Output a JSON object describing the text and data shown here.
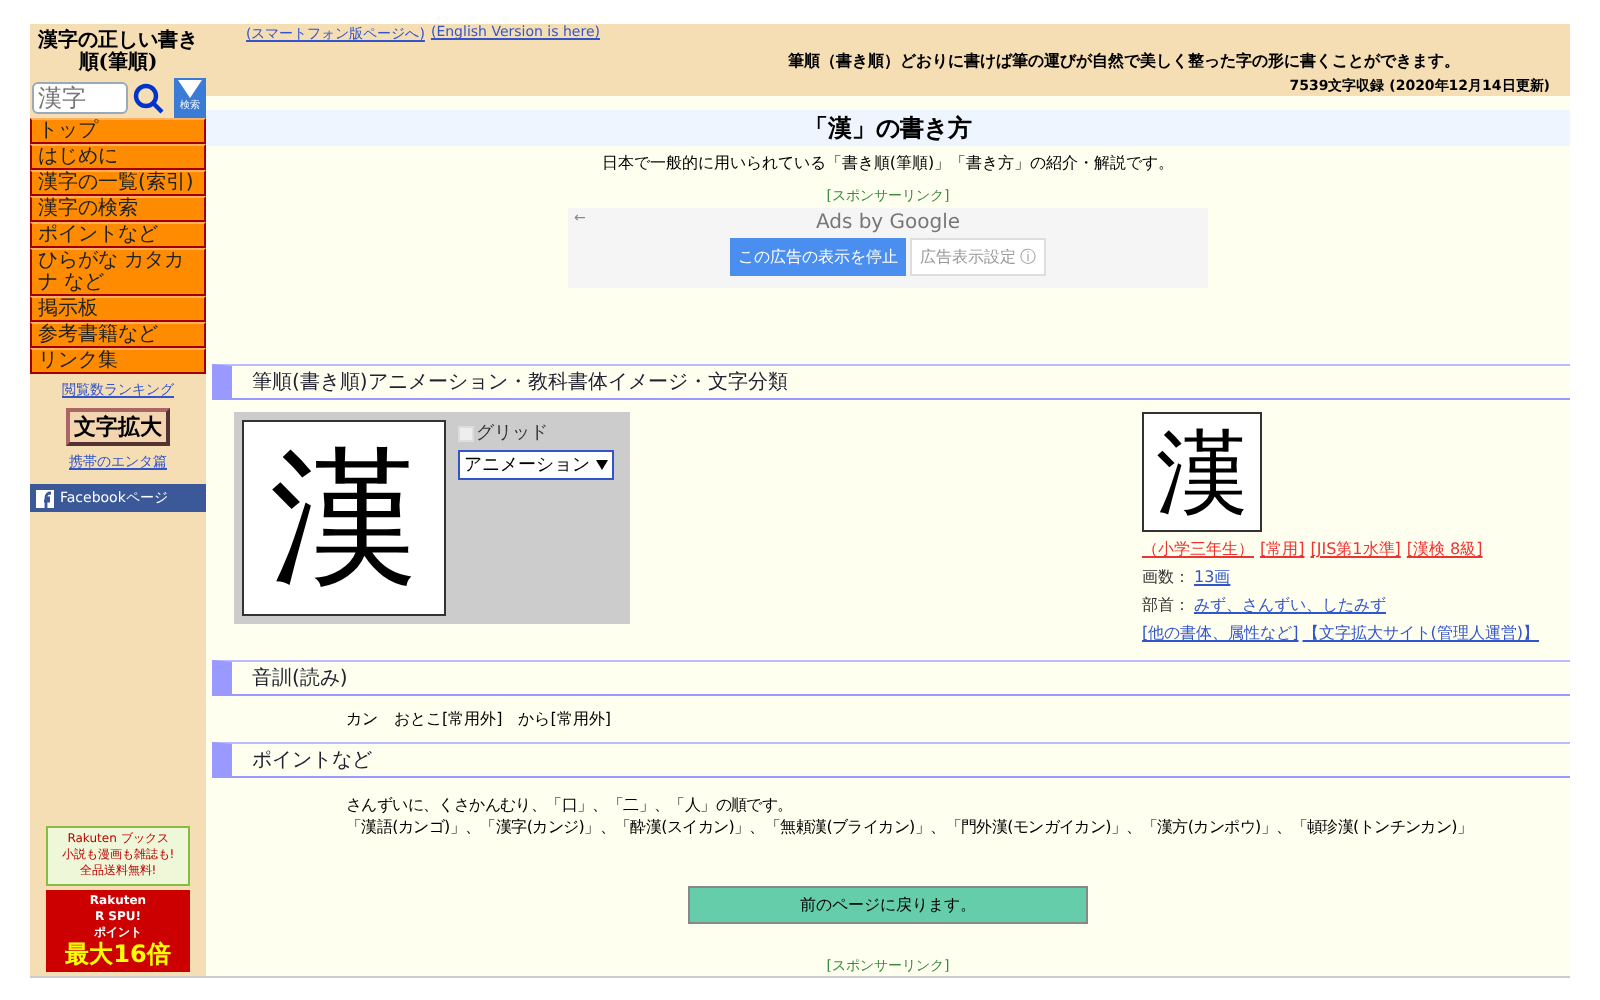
{
  "sidebar": {
    "logo": "漢字の正しい書き順(筆順)",
    "search": {
      "placeholder": "漢字"
    },
    "search_button": "検索",
    "menu": [
      "トップ",
      "はじめに",
      "漢字の一覧(索引)",
      "漢字の検索",
      "ポイントなど",
      "ひらがな カタカナ など",
      "掲示板",
      "参考書籍など",
      "リンク集"
    ],
    "ranking_link": "閲覧数ランキング",
    "zoom_button": "文字拡大",
    "zoom_link": "携帯のエンタ篇",
    "facebook_button": "Facebookページ",
    "banners": [
      {
        "lines": [
          "Rakuten ブックス",
          "小説も漫画も雑誌も!",
          "全品送料無料!"
        ]
      },
      {
        "lines": [
          "Rakuten",
          "R SPU!",
          "ポイント",
          "最大16倍"
        ]
      }
    ]
  },
  "header": {
    "links": [
      "(スマートフォン版ページへ)",
      "(English Version is here)"
    ],
    "tagline": "筆順（書き順）どおりに書けば筆の運びが自然で美しく整った字の形に書くことができます。",
    "count": "7539文字収録 (2020年12月14日更新)"
  },
  "title": "「漢」の書き方",
  "intro": "日本で一般的に用いられている「書き順(筆順)」「書き方」の紹介・解説です。",
  "sponsor": "[スポンサーリンク]",
  "ad": {
    "back": "←",
    "ads_by": "Ads by Google",
    "stop_button": "この広告の表示を停止",
    "settings_button": "広告表示設定 ⓘ"
  },
  "sections": [
    {
      "heading": "筆順(書き順)アニメーション・教科書体イメージ・文字分類"
    },
    {
      "heading": "音訓(読み)"
    },
    {
      "heading": "ポイントなど"
    }
  ],
  "stroke_panel": {
    "kanji": "漢",
    "grid": {
      "label": "グリッド",
      "checked": false
    },
    "mode": "アニメーション"
  },
  "info": {
    "kanji": "漢",
    "tags": [
      "（小学三年生）",
      "[常用]",
      "[JIS第1水準]",
      "[漢検 8級]"
    ],
    "strokes_label": "画数：",
    "strokes": "13画",
    "radical_label": "部首：",
    "radical": "みず、さんずい、したみず",
    "links": [
      "[他の書体、属性など]",
      "【文字拡大サイト(管理人運営)】"
    ]
  },
  "readings": "カン　おとこ[常用外]　から[常用外]",
  "points": [
    "さんずいに、くさかんむり、「口」、「二」、「人」の順です。",
    "「漢語(カンゴ)」、「漢字(カンジ)」、「酔漢(スイカン)」、「無頼漢(ブライカン)」、「門外漢(モンガイカン)」、「漢方(カンポウ)」、「頓珍漢(トンチンカン)」"
  ],
  "back_button": "前のページに戻ります。",
  "bottom_sponsor": "[スポンサーリンク]"
}
